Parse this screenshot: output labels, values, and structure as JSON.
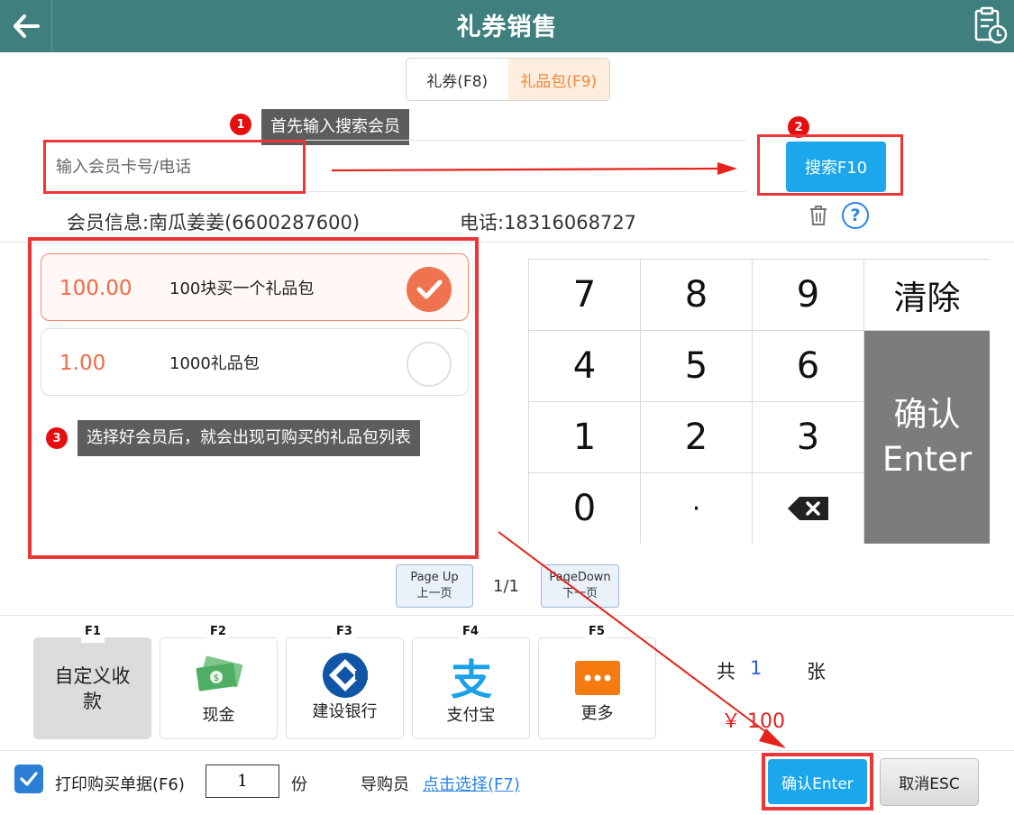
{
  "header": {
    "title": "礼券销售"
  },
  "tabs": [
    {
      "label": "礼券(F8)",
      "active": false
    },
    {
      "label": "礼品包(F9)",
      "active": true
    }
  ],
  "annotations": {
    "step1_num": "1",
    "step1_text": "首先输入搜索会员",
    "step2_num": "2",
    "step3_num": "3",
    "step3_text": "选择好会员后，就会出现可购买的礼品包列表"
  },
  "search": {
    "placeholder": "输入会员卡号/电话",
    "value": "",
    "button_label": "搜索F10"
  },
  "member": {
    "info": "会员信息:南瓜姜姜(6600287600)",
    "phone": "电话:18316068727"
  },
  "gifts": [
    {
      "price": "100.00",
      "name": "100块买一个礼品包",
      "selected": true
    },
    {
      "price": "1.00",
      "name": "1000礼品包",
      "selected": false
    }
  ],
  "keypad": {
    "k7": "7",
    "k8": "8",
    "k9": "9",
    "clear": "清除",
    "k4": "4",
    "k5": "5",
    "k6": "6",
    "k1": "1",
    "k2": "2",
    "k3": "3",
    "k0": "0",
    "dot": "·",
    "confirm_line1": "确认",
    "confirm_line2": "Enter"
  },
  "pagination": {
    "prev_line1": "Page Up",
    "prev_line2": "上一页",
    "page": "1/1",
    "next_line1": "PageDown",
    "next_line2": "下一页"
  },
  "payments": {
    "f1_key": "F1",
    "f1_label": "自定义收款",
    "f2_key": "F2",
    "f2_label": "现金",
    "f3_key": "F3",
    "f3_label": "建设银行",
    "f4_key": "F4",
    "f4_label": "支付宝",
    "f5_key": "F5",
    "f5_label": "更多"
  },
  "total": {
    "prefix": "共",
    "count": "1",
    "unit": "张",
    "amount": "￥ 100"
  },
  "footer": {
    "print_label": "打印购买单据(F6)",
    "copies": "1",
    "copies_unit": "份",
    "guide_label": "导购员",
    "guide_link": "点击选择(F7)",
    "confirm_label": "确认Enter",
    "cancel_label": "取消ESC"
  },
  "colors": {
    "header": "#3f7f7d",
    "accent_blue": "#1ca7ec",
    "accent_orange": "#f0734f",
    "annotation_red": "#ee3535",
    "price_orange": "#ee6b45"
  },
  "icons": {
    "back": "arrow-left-icon",
    "history": "clipboard-clock-icon",
    "trash": "trash-icon",
    "help": "question-icon",
    "check": "checkmark-icon",
    "backspace": "backspace-icon",
    "cash": "cash-icon",
    "ccb": "ccb-logo-icon",
    "alipay": "alipay-icon",
    "more": "more-icon"
  }
}
